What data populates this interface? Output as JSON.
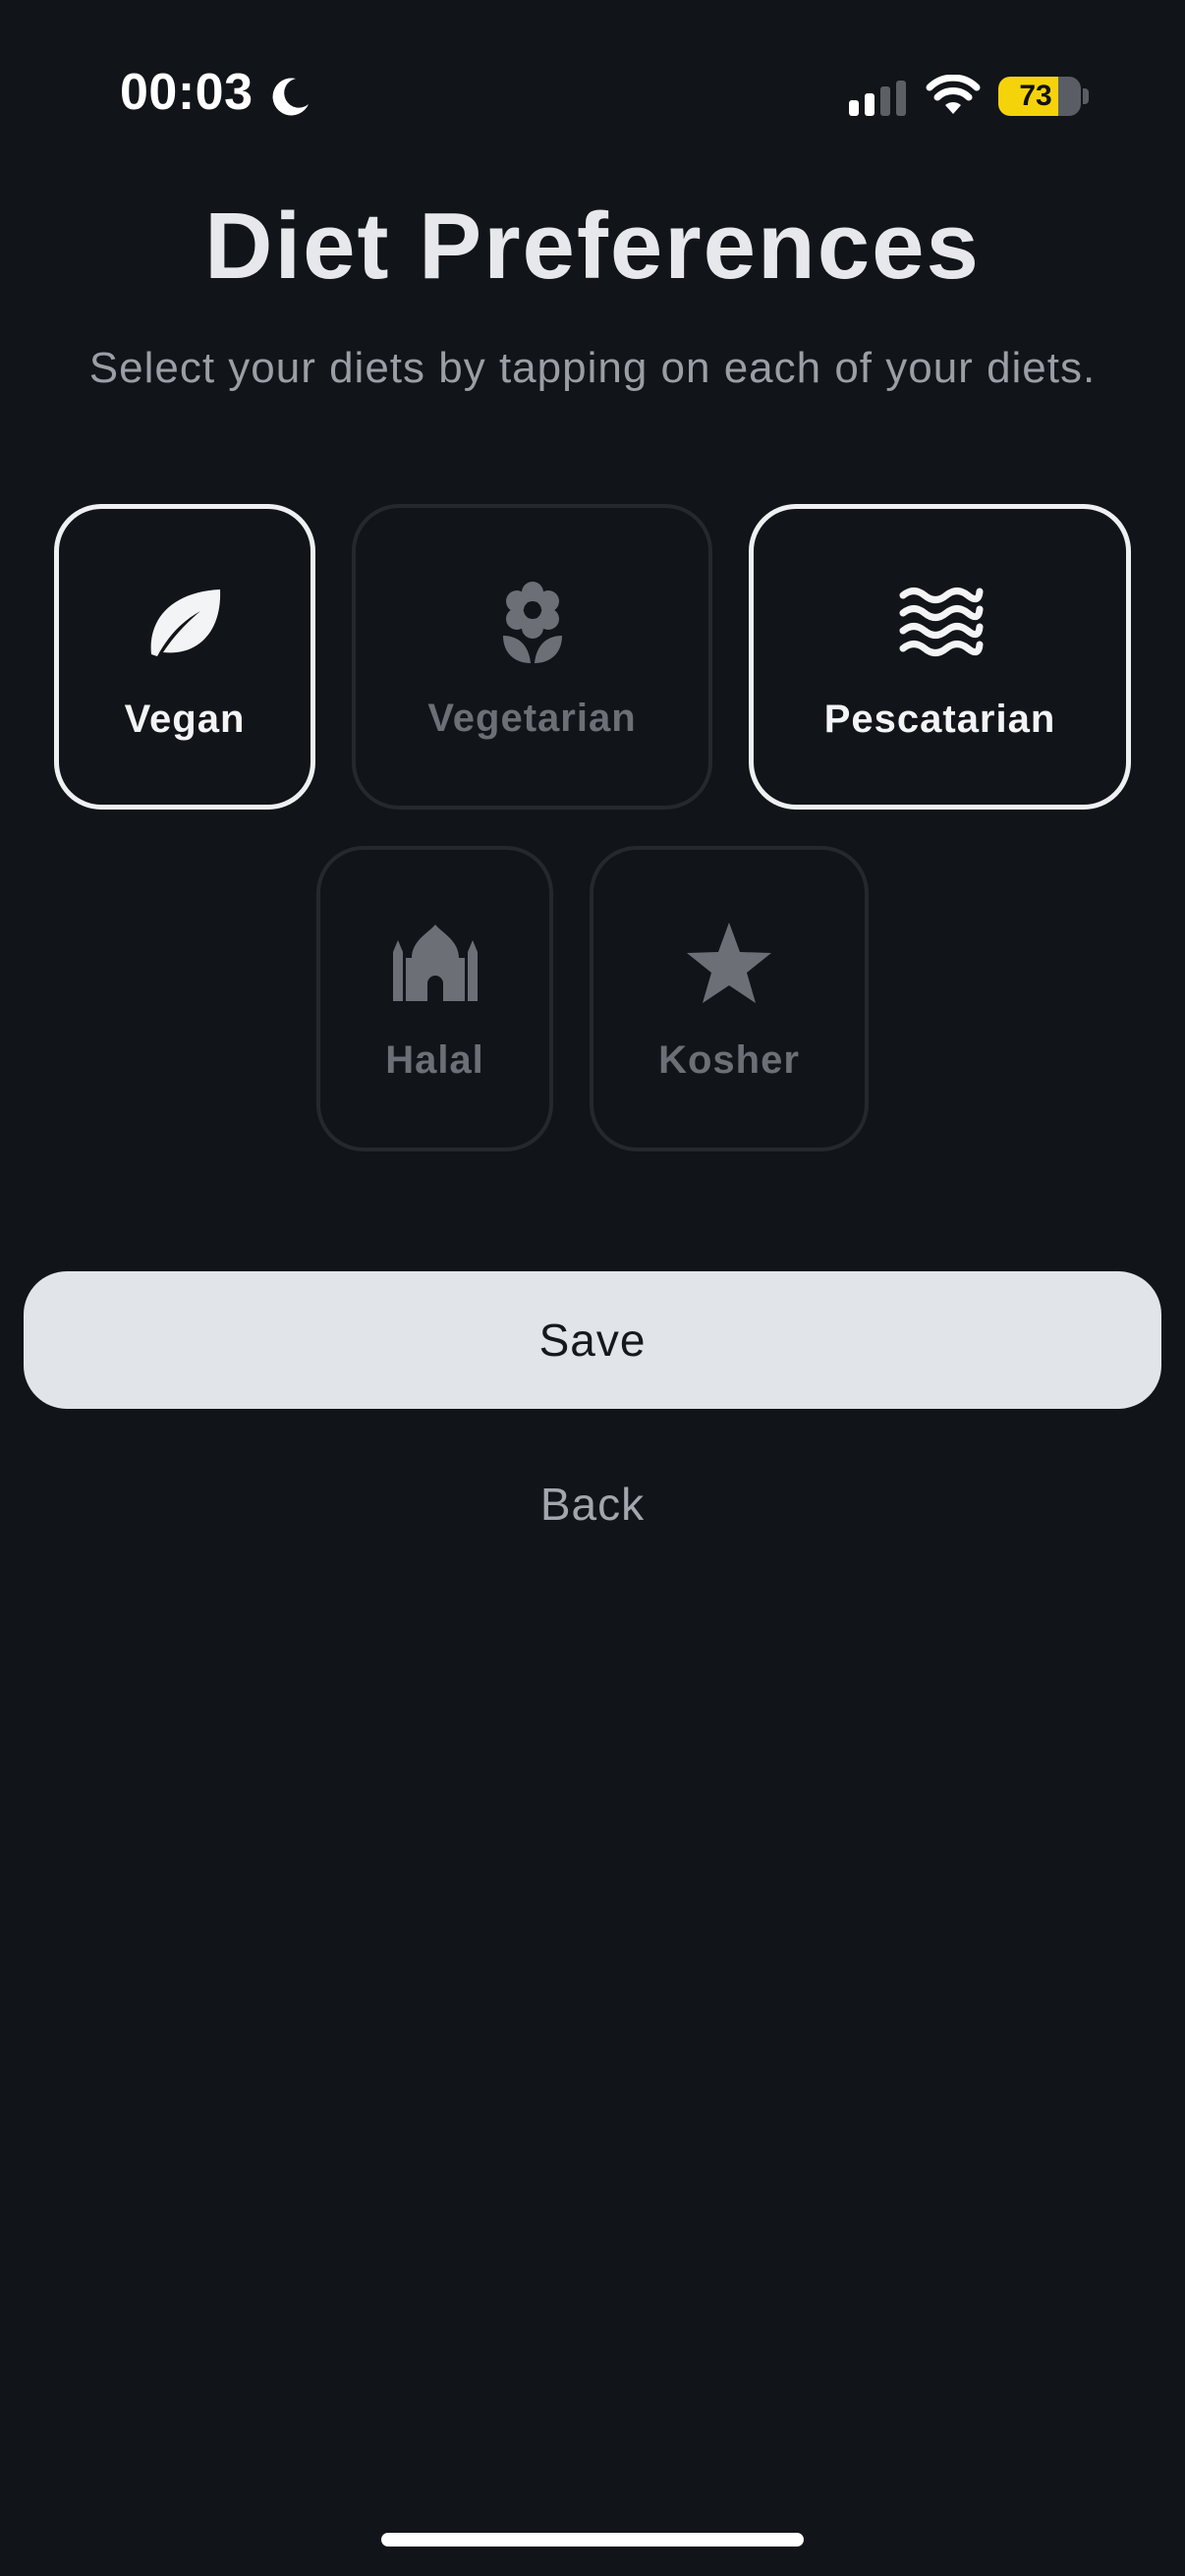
{
  "status_bar": {
    "time": "00:03",
    "battery_percent": "73",
    "battery_level": 0.73,
    "icons": [
      "moon-icon",
      "signal-icon",
      "wifi-icon",
      "battery-icon"
    ]
  },
  "header": {
    "title": "Diet Preferences",
    "subtitle": "Select your diets by tapping on each of your diets."
  },
  "diets": [
    {
      "label": "Vegan",
      "icon": "leaf-icon",
      "selected": true
    },
    {
      "label": "Vegetarian",
      "icon": "flower-icon",
      "selected": false
    },
    {
      "label": "Pescatarian",
      "icon": "waves-icon",
      "selected": true
    },
    {
      "label": "Halal",
      "icon": "mosque-icon",
      "selected": false
    },
    {
      "label": "Kosher",
      "icon": "star-icon",
      "selected": false
    }
  ],
  "actions": {
    "save_label": "Save",
    "back_label": "Back"
  },
  "colors": {
    "background": "#111418",
    "selected_border": "#eef0f2",
    "unselected_border": "#25282d",
    "selected_text": "#f3f4f6",
    "unselected_text": "#6c7076",
    "save_button_bg": "#e1e4e8",
    "battery_accent": "#f5d30a"
  }
}
